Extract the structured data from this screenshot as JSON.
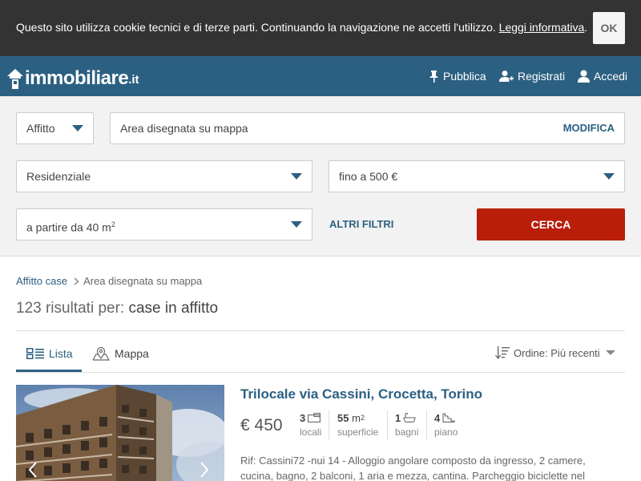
{
  "cookie": {
    "message": "Questo sito utilizza cookie tecnici e di terze parti. Continuando la navigazione ne accetti l'utilizzo.",
    "link": "Leggi informativa",
    "suffix": ".",
    "ok": "OK"
  },
  "header": {
    "logo_main": "immobiliare",
    "logo_tld": ".it",
    "nav": {
      "pubblica": "Pubblica",
      "registrati": "Registrati",
      "accedi": "Accedi"
    }
  },
  "search": {
    "contract": "Affitto",
    "area": "Area disegnata su mappa",
    "modify": "MODIFICA",
    "type": "Residenziale",
    "price": "fino a 500 €",
    "size_prefix": "a partire da 40 m",
    "size_exp": "2",
    "more_filters": "ALTRI FILTRI",
    "submit": "CERCA"
  },
  "breadcrumb": {
    "link": "Affitto case",
    "current": "Area disegnata su mappa"
  },
  "results": {
    "prefix": "123 risultati per:",
    "query": "case in affitto"
  },
  "views": {
    "list": "Lista",
    "map": "Mappa"
  },
  "order": {
    "label": "Ordine:",
    "value": "Più recenti"
  },
  "listing": {
    "title": "Trilocale via Cassini, Crocetta, Torino",
    "price": "€ 450",
    "features": {
      "locali": {
        "value": "3",
        "label": "locali"
      },
      "superficie": {
        "value": "55",
        "unit": "m",
        "unit_exp": "2",
        "label": "superficie"
      },
      "bagni": {
        "value": "1",
        "label": "bagni"
      },
      "piano": {
        "value": "4",
        "label": "piano"
      }
    },
    "description": "Rif: Cassini72 -nui 14 - Alloggio angolare composto da ingresso, 2 camere, cucina, bagno, 2 balconi, 1 aria e mezza, cantina. Parcheggio biciclette nel"
  },
  "colors": {
    "header": "#2c6082",
    "accent": "#2c6082",
    "cta": "#b81e0a",
    "cookie_bg": "#333333"
  }
}
